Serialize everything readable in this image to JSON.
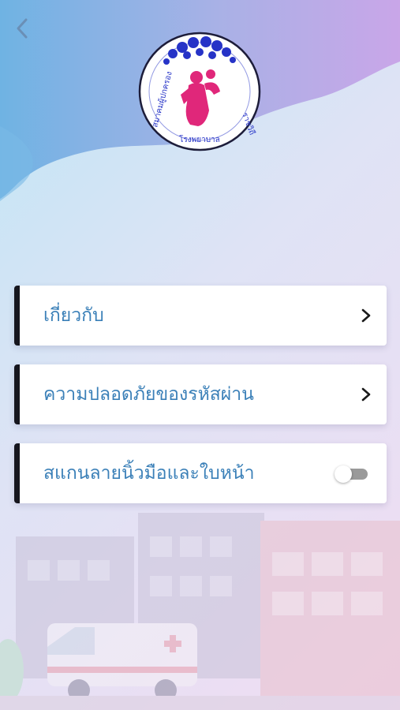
{
  "header": {
    "back_icon": "chevron-left-icon",
    "logo_text": "สมาคมผู้ปกครองและครู โรงพยาบาลราชวิถี"
  },
  "menu": {
    "about_label": "เกี่ยวกับ",
    "password_security_label": "ความปลอดภัยของรหัสผ่าน",
    "biometric_label": "สแกนลายนิ้วมือและใบหน้า",
    "biometric_enabled": false
  },
  "colors": {
    "label_text": "#3b80b8",
    "accent_bar": "#16161e",
    "wave_top": "#6fb3e3",
    "wave_bottom": "#c9a6e8"
  }
}
